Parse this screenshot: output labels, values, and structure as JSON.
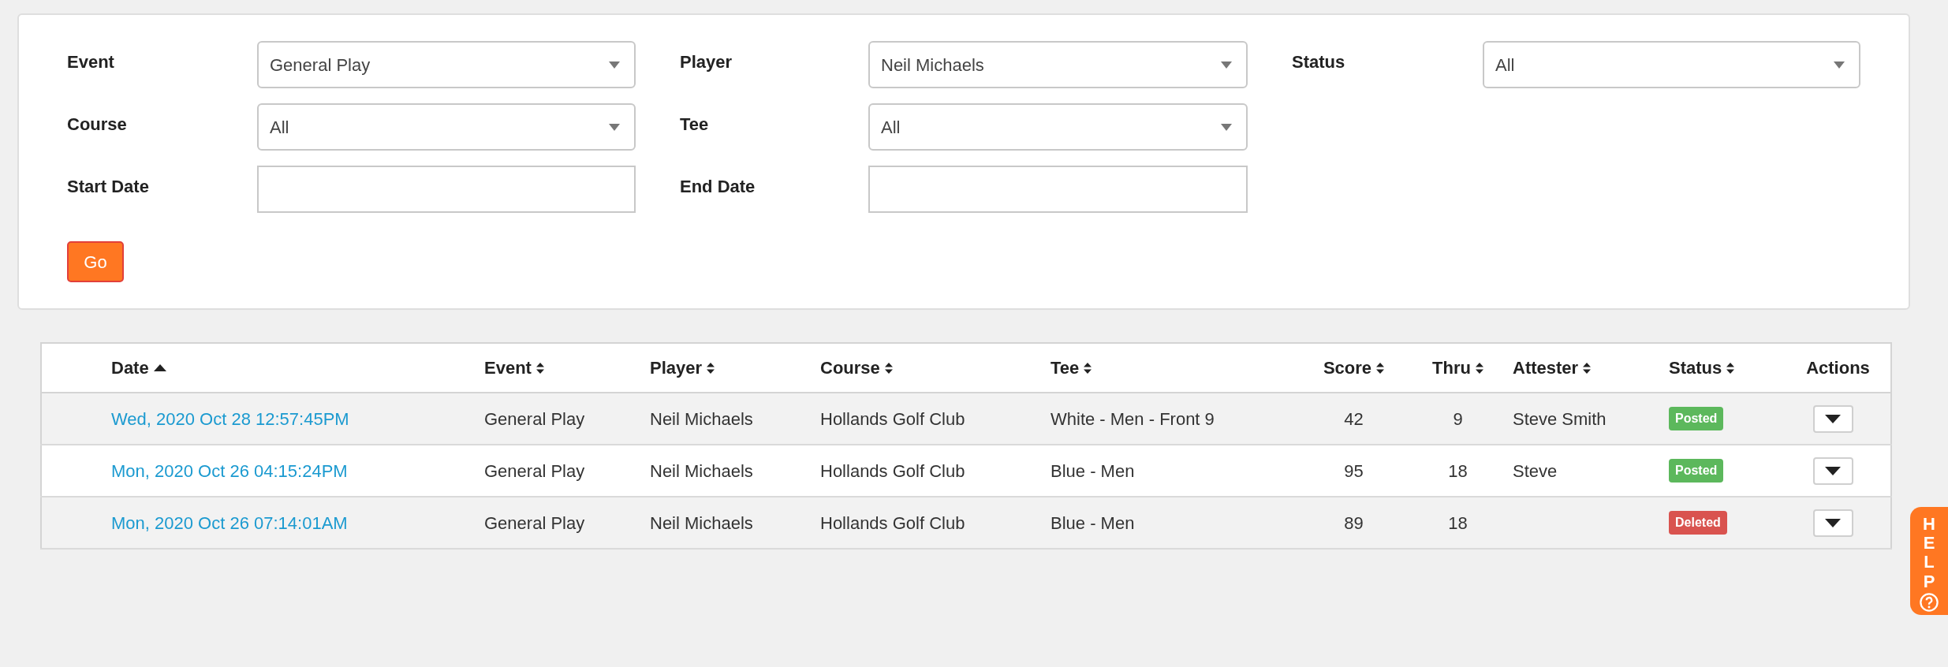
{
  "filters": {
    "rows": [
      [
        {
          "label": "Event",
          "kind": "select",
          "value": "General Play"
        },
        {
          "label": "Player",
          "kind": "select",
          "value": "Neil Michaels"
        },
        {
          "label": "Status",
          "kind": "select",
          "value": "All"
        }
      ],
      [
        {
          "label": "Course",
          "kind": "select",
          "value": "All"
        },
        {
          "label": "Tee",
          "kind": "select",
          "value": "All"
        }
      ],
      [
        {
          "label": "Start Date",
          "kind": "date"
        },
        {
          "label": "End Date",
          "kind": "date"
        }
      ]
    ],
    "submit": "Go"
  },
  "table": {
    "columns": [
      {
        "label": "Date",
        "sortable": true,
        "sorted_ascending": true
      },
      {
        "label": "Event",
        "sortable": true,
        "sorted_ascending": false
      },
      {
        "label": "Player",
        "sortable": true,
        "sorted_ascending": false
      },
      {
        "label": "Course",
        "sortable": true,
        "sorted_ascending": false
      },
      {
        "label": "Tee",
        "sortable": true,
        "sorted_ascending": false
      },
      {
        "label": "Score",
        "sortable": true,
        "sorted_ascending": false
      },
      {
        "label": "Thru",
        "sortable": true,
        "sorted_ascending": false
      },
      {
        "label": "Attester",
        "sortable": true,
        "sorted_ascending": false
      },
      {
        "label": "Status",
        "sortable": true,
        "sorted_ascending": false
      },
      {
        "label": "Actions",
        "sortable": false,
        "sorted_ascending": false
      }
    ],
    "rows": [
      {
        "date": "Wed, 2020 Oct 28 12:57:45PM",
        "event": "General Play",
        "player": "Neil Michaels",
        "course": "Hollands Golf Club",
        "tee": "White - Men - Front 9",
        "score": "42",
        "thru": "9",
        "attester": "Steve Smith",
        "status": {
          "label": "Posted",
          "color": "#5cb85c"
        }
      },
      {
        "date": "Mon, 2020 Oct 26 04:15:24PM",
        "event": "General Play",
        "player": "Neil Michaels",
        "course": "Hollands Golf Club",
        "tee": "Blue - Men",
        "score": "95",
        "thru": "18",
        "attester": "Steve",
        "status": {
          "label": "Posted",
          "color": "#5cb85c"
        }
      },
      {
        "date": "Mon, 2020 Oct 26 07:14:01AM",
        "event": "General Play",
        "player": "Neil Michaels",
        "course": "Hollands Golf Club",
        "tee": "Blue - Men",
        "score": "89",
        "thru": "18",
        "status": {
          "label": "Deleted",
          "color": "#d9534f"
        }
      }
    ]
  },
  "help_tab": {
    "label": "HELP"
  }
}
